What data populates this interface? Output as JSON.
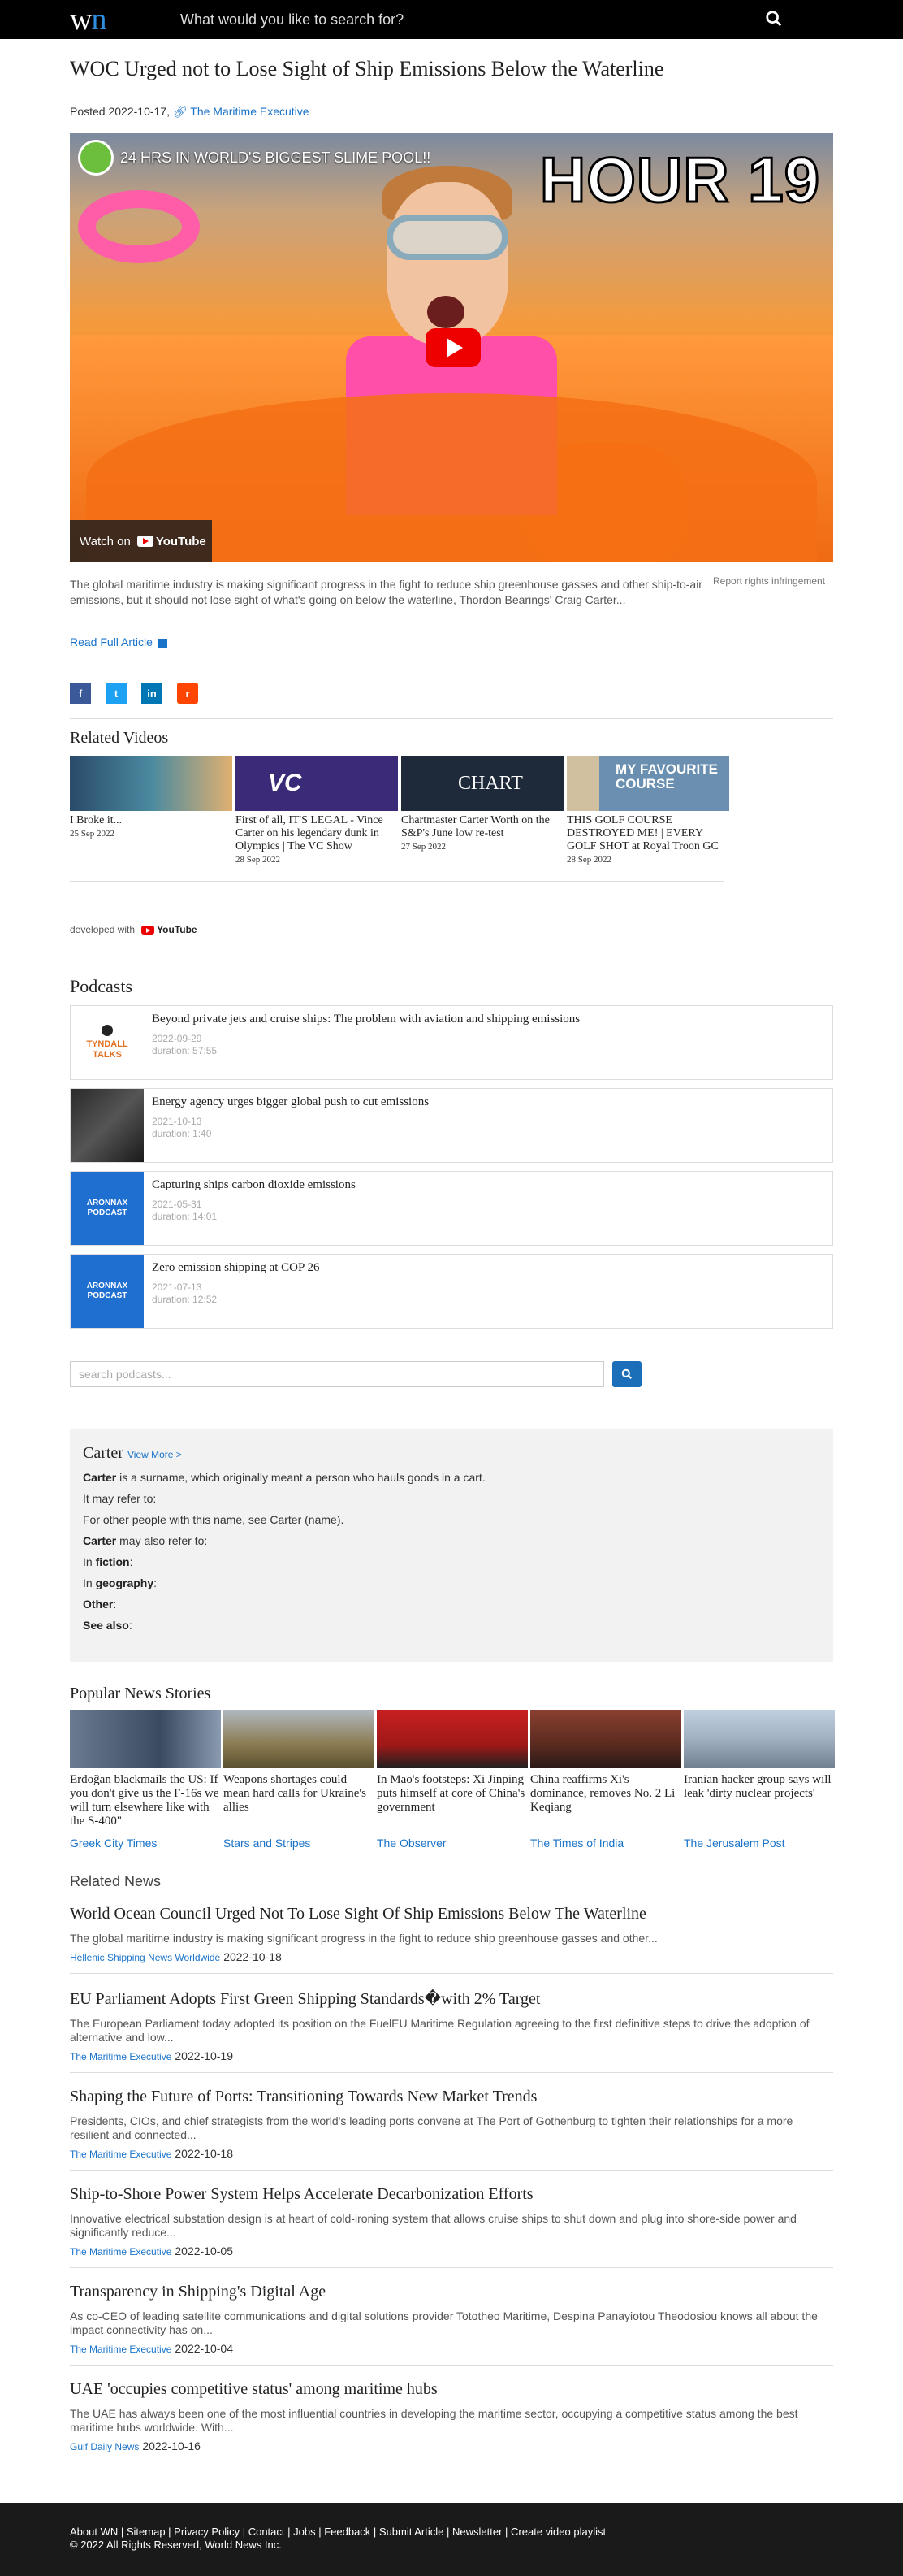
{
  "header": {
    "logo_w": "w",
    "logo_n": "n",
    "search_placeholder": "What would you like to search for?"
  },
  "article": {
    "title": "WOC Urged not to Lose Sight of Ship Emissions Below the Waterline",
    "posted_label": "Posted 2022-10-17,",
    "source": "The Maritime Executive",
    "video_title": "24 HRS IN WORLD'S BIGGEST SLIME POOL!!",
    "video_overlay": "HOUR 19",
    "watch_on": "Watch on",
    "youtube": "YouTube",
    "summary": "The global maritime industry is making significant progress in the fight to reduce ship greenhouse gasses and other ship-to-air emissions, but it should not lose sight of what's going on below the waterline, Thordon Bearings' Craig Carter...",
    "report": "Report rights infringement",
    "read_full": "Read Full Article"
  },
  "share": {
    "facebook": "f",
    "twitter": "t",
    "linkedin": "in",
    "reddit": "r"
  },
  "related_videos": {
    "title": "Related Videos",
    "items": [
      {
        "title": "I Broke it...",
        "date": "25 Sep 2022",
        "color": "#3a6a8a"
      },
      {
        "title": "First of all, IT'S LEGAL - Vince Carter on his legendary dunk in Olympics | The VC Show",
        "date": "28 Sep 2022",
        "color": "#3b2a78"
      },
      {
        "title": "Chartmaster Carter Worth on the S&P's June low re-test",
        "date": "27 Sep 2022",
        "color": "#1e2a3a"
      },
      {
        "title": "THIS GOLF COURSE DESTROYED ME! | EVERY GOLF SHOT at Royal Troon GC",
        "date": "28 Sep 2022",
        "color": "#6a8fb0"
      }
    ],
    "thumb_texts": [
      "",
      "VC",
      "CHART",
      "MY FAVOURITE COURSE"
    ],
    "developed_with": "developed with",
    "youtube": "YouTube"
  },
  "podcasts": {
    "title": "Podcasts",
    "items": [
      {
        "title": "Beyond private jets and cruise ships: The problem with aviation and shipping emissions",
        "date": "2022-09-29",
        "duration": "duration: 57:55",
        "logo_text": "TYNDALL TALKS"
      },
      {
        "title": "Energy agency urges bigger global push to cut emissions",
        "date": "2021-10-13",
        "duration": "duration: 1:40",
        "logo_text": ""
      },
      {
        "title": "Capturing ships carbon dioxide emissions",
        "date": "2021-05-31",
        "duration": "duration: 14:01",
        "logo_text": "ARONNAX PODCAST"
      },
      {
        "title": "Zero emission shipping at COP 26",
        "date": "2021-07-13",
        "duration": "duration: 12:52",
        "logo_text": "ARONNAX PODCAST"
      }
    ],
    "search_placeholder": "search podcasts..."
  },
  "wiki": {
    "title": "Carter",
    "view_more": "View More >",
    "lines": [
      {
        "bold": "Carter",
        "text": " is a surname, which originally meant a person who hauls goods in a cart."
      },
      {
        "bold": "",
        "text": "It may refer to:"
      },
      {
        "bold": "",
        "text": "For other people with this name, see Carter (name)."
      },
      {
        "bold": "Carter",
        "text": " may also refer to:"
      },
      {
        "bold": "",
        "text": "In ",
        "bold2": "fiction",
        "tail": ":"
      },
      {
        "bold": "",
        "text": "In ",
        "bold2": "geography",
        "tail": ":"
      },
      {
        "bold": "Other",
        "text": ":"
      },
      {
        "bold": "See also",
        "text": ":"
      }
    ]
  },
  "popular": {
    "title": "Popular News Stories",
    "items": [
      {
        "title": "Erdoğan blackmails the US: If you don't give us the F-16s we will turn elsewhere like with the S-400\"",
        "source": "Greek City Times",
        "color": "#4a5a70"
      },
      {
        "title": "Weapons shortages could mean hard calls for Ukraine's allies",
        "source": "Stars and Stripes",
        "color": "#8a8060"
      },
      {
        "title": "In Mao's footsteps: Xi Jinping puts himself at core of China's government",
        "source": "The Observer",
        "color": "#b82020"
      },
      {
        "title": "China reaffirms Xi's dominance, removes No. 2 Li Keqiang",
        "source": "The Times of India",
        "color": "#7a3a2a"
      },
      {
        "title": "Iranian hacker group says will leak 'dirty nuclear projects'",
        "source": "The Jerusalem Post",
        "color": "#8aa0b8"
      }
    ]
  },
  "related_news": {
    "title": "Related News",
    "items": [
      {
        "title": "World Ocean Council Urged Not To Lose Sight Of Ship Emissions Below The Waterline",
        "excerpt": "The global maritime industry is making significant progress in the fight to reduce ship greenhouse gasses and other...",
        "source": "Hellenic Shipping News Worldwide",
        "date": "2022-10-18"
      },
      {
        "title": "EU Parliament Adopts First Green Shipping Standards�with 2% Target",
        "excerpt": "The European Parliament today adopted its position on the FuelEU Maritime Regulation agreeing to the first definitive steps to drive the adoption of alternative and low...",
        "source": "The Maritime Executive",
        "date": "2022-10-19"
      },
      {
        "title": "Shaping the Future of Ports: Transitioning Towards New Market Trends",
        "excerpt": "Presidents, CIOs, and chief strategists from the world's leading ports convene at The Port of Gothenburg to tighten their relationships for a more resilient and connected...",
        "source": "The Maritime Executive",
        "date": "2022-10-18"
      },
      {
        "title": "Ship-to-Shore Power System Helps Accelerate Decarbonization Efforts",
        "excerpt": "Innovative electrical substation design is at heart of cold-ironing system that allows cruise ships to shut down and plug into shore-side power and significantly reduce...",
        "source": "The Maritime Executive",
        "date": "2022-10-05"
      },
      {
        "title": "Transparency in Shipping's Digital Age",
        "excerpt": "As co-CEO of leading satellite communications and digital solutions provider Tototheo Maritime, Despina Panayiotou Theodosiou knows all about the impact connectivity has on...",
        "source": "The Maritime Executive",
        "date": "2022-10-04"
      },
      {
        "title": "UAE 'occupies competitive status' among maritime hubs",
        "excerpt": "The UAE has always been one of the most influential countries in developing the maritime sector, occupying a competitive status among the best maritime hubs worldwide. With...",
        "source": "Gulf Daily News",
        "date": "2022-10-16"
      }
    ]
  },
  "footer": {
    "links": [
      "About WN",
      "Sitemap",
      "Privacy Policy",
      "Contact",
      "Jobs",
      "Feedback",
      "Submit Article",
      "Newsletter",
      "Create video playlist"
    ],
    "separator": " | ",
    "copyright": "© 2022 All Rights Reserved, World News Inc."
  }
}
